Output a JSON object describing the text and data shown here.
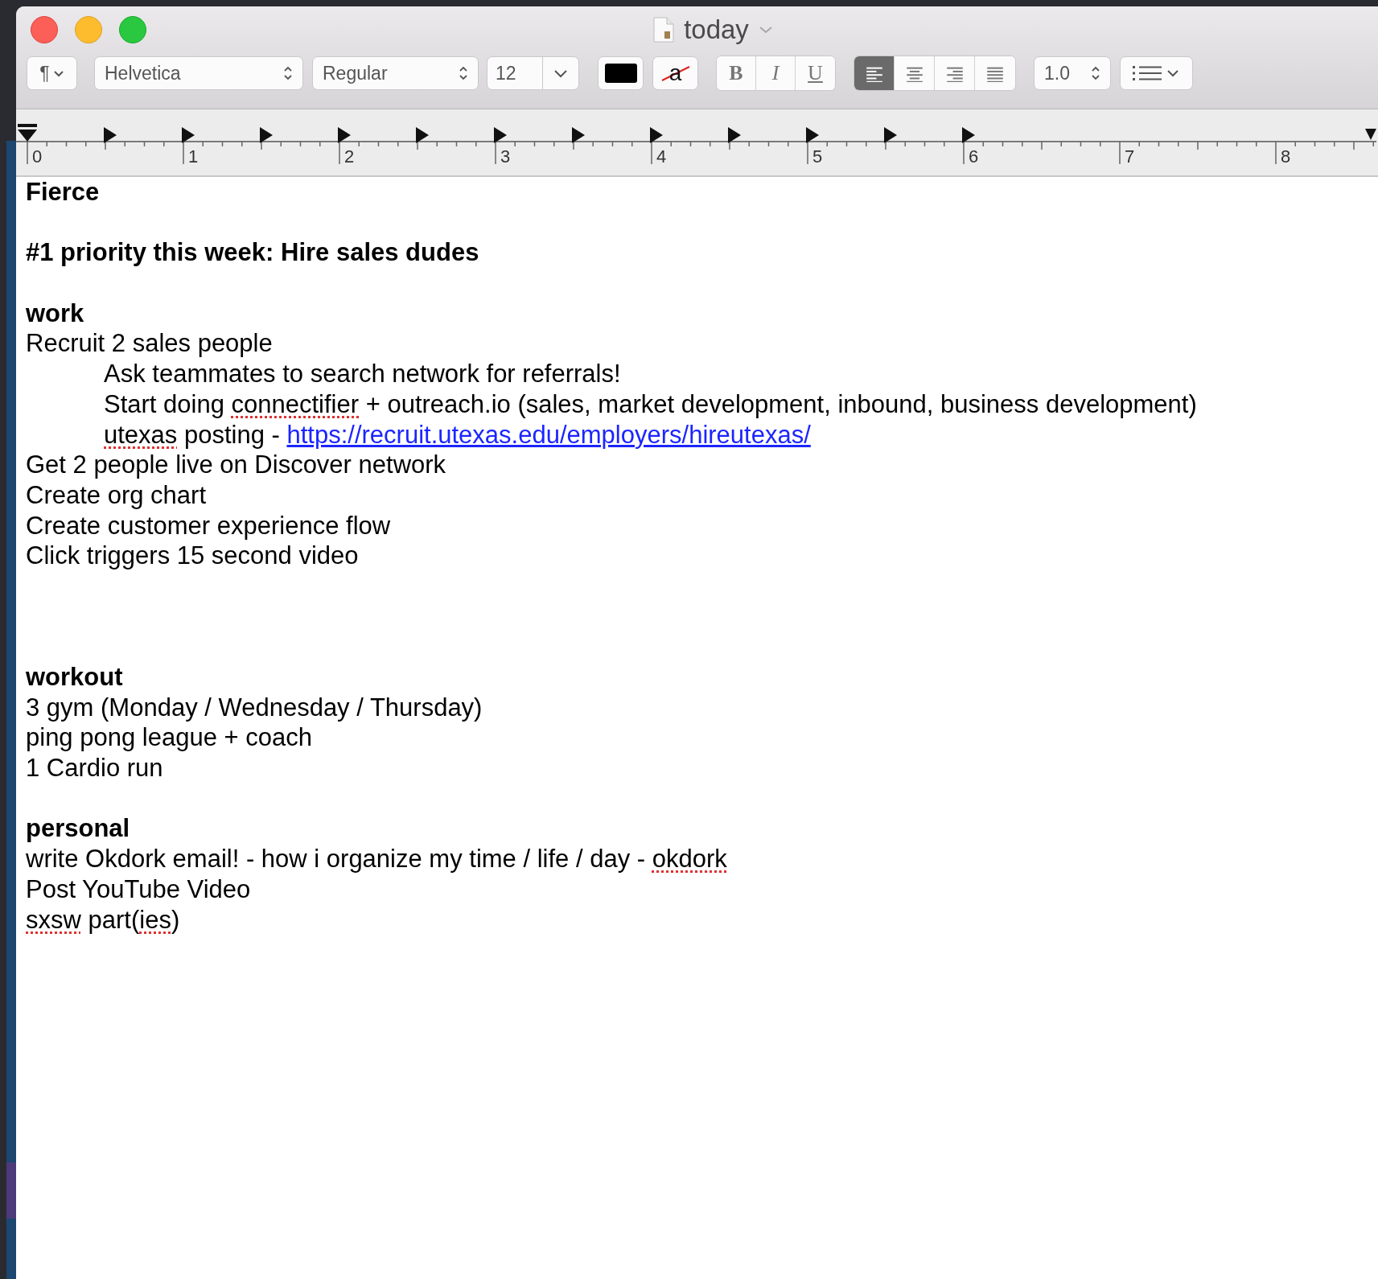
{
  "window": {
    "title": "today"
  },
  "toolbar": {
    "paragraph_style": "¶",
    "font_family": "Helvetica",
    "typeface": "Regular",
    "font_size": "12",
    "highlight_glyph": "a",
    "styles": [
      {
        "label": "B",
        "kind": "bold",
        "selected": false
      },
      {
        "label": "I",
        "kind": "italic",
        "selected": false
      },
      {
        "label": "U",
        "kind": "underline",
        "selected": false
      }
    ],
    "alignment": [
      {
        "kind": "left",
        "selected": true
      },
      {
        "kind": "center",
        "selected": false
      },
      {
        "kind": "right",
        "selected": false
      },
      {
        "kind": "justify",
        "selected": false
      }
    ],
    "line_spacing": "1.0"
  },
  "ruler": {
    "labels": [
      "0",
      "1",
      "2",
      "3",
      "4",
      "5",
      "6",
      "7",
      "8"
    ]
  },
  "document": {
    "paragraphs": [
      {
        "kind": "heading",
        "text": "Fierce"
      },
      {
        "kind": "blank"
      },
      {
        "kind": "heading",
        "text": "#1 priority this week: Hire sales dudes"
      },
      {
        "kind": "blank"
      },
      {
        "kind": "heading",
        "text": "work"
      },
      {
        "kind": "text",
        "parts": [
          {
            "kind": "plain",
            "text": "Recruit 2 sales people"
          }
        ],
        "children": [
          {
            "kind": "text",
            "parts": [
              {
                "kind": "plain",
                "text": "Ask teammates to search network for referrals!"
              }
            ]
          },
          {
            "kind": "text",
            "parts": [
              {
                "kind": "plain",
                "text": "Start doing "
              },
              {
                "kind": "misspelled",
                "text": "connectifier"
              },
              {
                "kind": "plain",
                "text": " + outreach.io (sales, market development, inbound, business development)"
              }
            ]
          },
          {
            "kind": "text",
            "parts": [
              {
                "kind": "misspelled",
                "text": "utexas"
              },
              {
                "kind": "plain",
                "text": " posting - "
              },
              {
                "kind": "link",
                "text": "https://recruit.utexas.edu/employers/hireutexas/"
              }
            ]
          }
        ]
      },
      {
        "kind": "text",
        "parts": [
          {
            "kind": "plain",
            "text": "Get 2 people live on Discover network"
          }
        ]
      },
      {
        "kind": "text",
        "parts": [
          {
            "kind": "plain",
            "text": "Create org chart"
          }
        ]
      },
      {
        "kind": "text",
        "parts": [
          {
            "kind": "plain",
            "text": "Create customer experience flow"
          }
        ]
      },
      {
        "kind": "text",
        "parts": [
          {
            "kind": "plain",
            "text": "Click triggers 15 second video"
          }
        ]
      },
      {
        "kind": "blank"
      },
      {
        "kind": "blank"
      },
      {
        "kind": "blank"
      },
      {
        "kind": "heading",
        "text": "workout"
      },
      {
        "kind": "text",
        "parts": [
          {
            "kind": "plain",
            "text": "3 gym (Monday / Wednesday / Thursday)"
          }
        ]
      },
      {
        "kind": "text",
        "parts": [
          {
            "kind": "plain",
            "text": "ping pong league + coach"
          }
        ]
      },
      {
        "kind": "text",
        "parts": [
          {
            "kind": "plain",
            "text": "1 Cardio run"
          }
        ]
      },
      {
        "kind": "blank"
      },
      {
        "kind": "heading",
        "text": "personal"
      },
      {
        "kind": "text",
        "parts": [
          {
            "kind": "plain",
            "text": "write Okdork email! - how i organize my time / life / day - "
          },
          {
            "kind": "misspelled",
            "text": "okdork"
          }
        ]
      },
      {
        "kind": "text",
        "parts": [
          {
            "kind": "plain",
            "text": "Post YouTube Video"
          }
        ]
      },
      {
        "kind": "text",
        "parts": [
          {
            "kind": "misspelled",
            "text": "sxsw"
          },
          {
            "kind": "plain",
            "text": " part("
          },
          {
            "kind": "misspelled",
            "text": "ies"
          },
          {
            "kind": "plain",
            "text": ")"
          }
        ]
      }
    ]
  }
}
